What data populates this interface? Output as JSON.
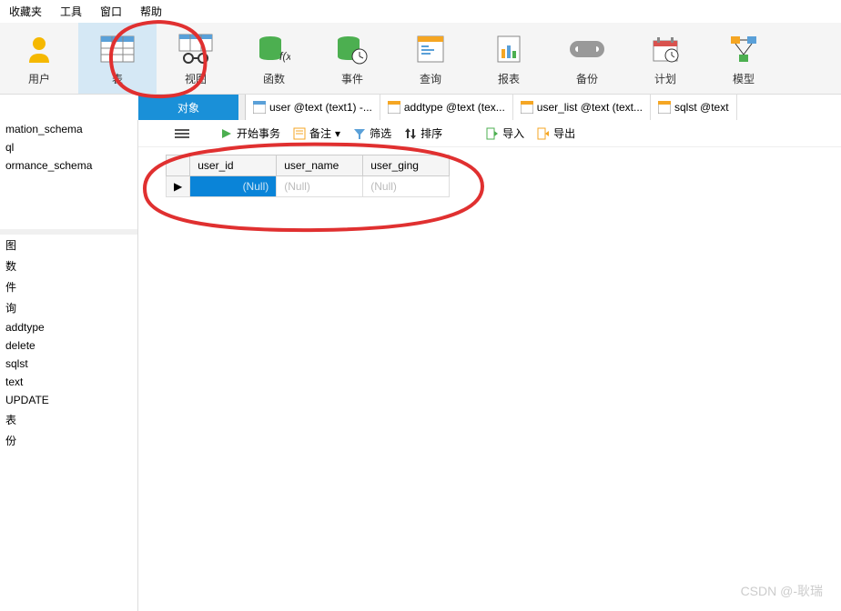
{
  "menu": {
    "favorites": "收藏夹",
    "tools": "工具",
    "window": "窗口",
    "help": "帮助"
  },
  "toolbar": {
    "user": "用户",
    "table": "表",
    "view": "视图",
    "func": "函数",
    "event": "事件",
    "query": "查询",
    "report": "报表",
    "backup": "备份",
    "schedule": "计划",
    "model": "模型"
  },
  "sub": {
    "object": "对象",
    "tab1": "user @text (text1) -...",
    "tab2": "addtype @text (tex...",
    "tab3": "user_list @text (text...",
    "tab4": "sqlst @text"
  },
  "actions": {
    "start_tx": "开始事务",
    "memo": "备注",
    "filter": "筛选",
    "sort": "排序",
    "import": "导入",
    "export": "导出"
  },
  "sidebar": {
    "items": [
      "mation_schema",
      "ql",
      "ormance_schema",
      "",
      "",
      "图",
      "数",
      "件",
      "询",
      "addtype",
      "delete",
      "sqlst",
      "text",
      "UPDATE",
      "表",
      "份"
    ]
  },
  "grid": {
    "headers": [
      "user_id",
      "user_name",
      "user_ging"
    ],
    "row1": {
      "marker": "▶",
      "c1": "(Null)",
      "c2": "(Null)",
      "c3": "(Null)"
    }
  },
  "watermark": "CSDN @-耿瑞"
}
